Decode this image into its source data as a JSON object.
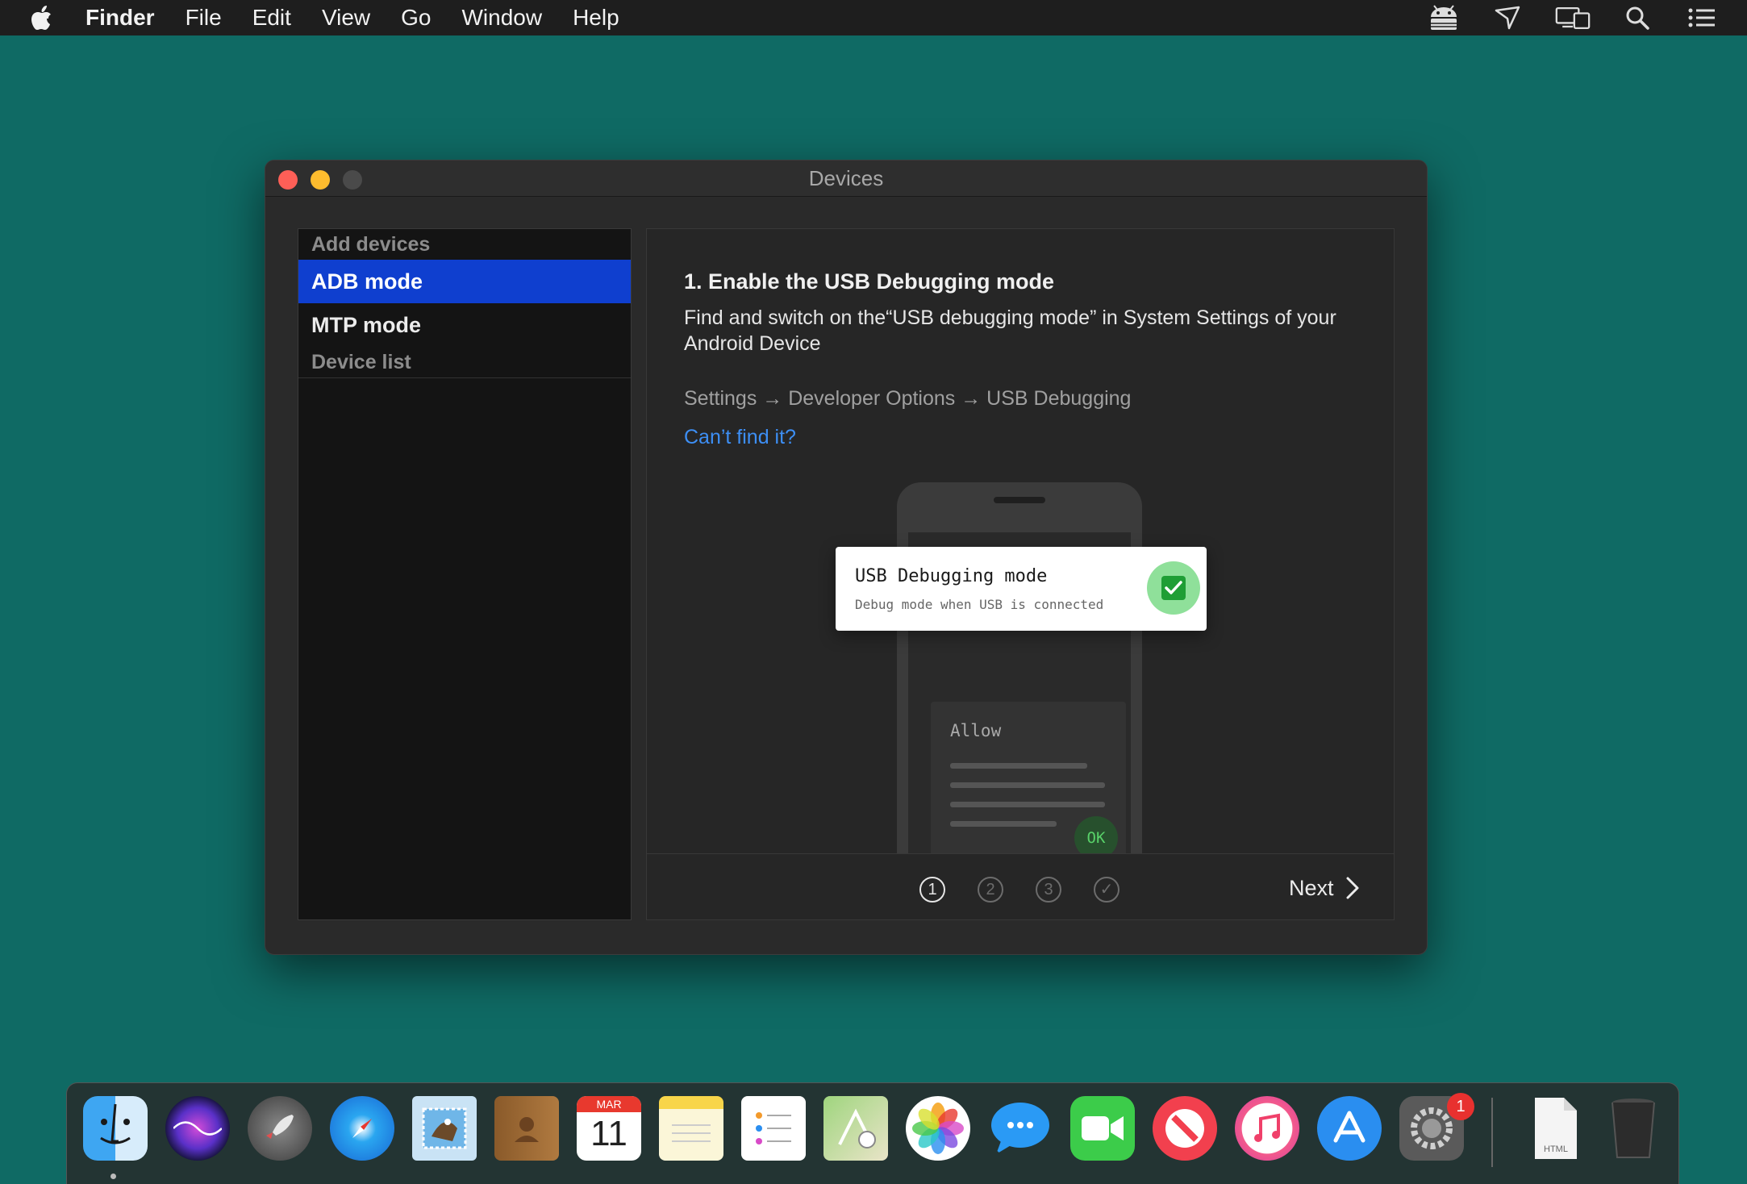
{
  "menubar": {
    "app_name": "Finder",
    "menus": [
      "File",
      "Edit",
      "View",
      "Go",
      "Window",
      "Help"
    ],
    "status_icons": [
      "android-icon",
      "airplay-icon",
      "display-icon",
      "search-icon",
      "list-icon"
    ]
  },
  "window": {
    "title": "Devices",
    "sidebar": {
      "header": "Add devices",
      "items": [
        {
          "label": "ADB mode",
          "selected": true
        },
        {
          "label": "MTP mode",
          "selected": false
        }
      ],
      "section": "Device list"
    },
    "main": {
      "step_title": "1. Enable the USB Debugging mode",
      "step_desc": "Find and switch on the“USB debugging mode” in System Settings of your Android Device",
      "path": "Settings → Developer Options → USB Debugging",
      "link": "Can’t find it?",
      "card": {
        "title": "USB Debugging mode",
        "subtitle": "Debug mode when USB is connected"
      },
      "allow_label": "Allow",
      "ok_label": "OK",
      "steps": [
        "1",
        "2",
        "3",
        "✓"
      ],
      "active_step": 1,
      "next_label": "Next"
    }
  },
  "dock": {
    "calendar_month": "MAR",
    "calendar_day": "11",
    "settings_badge": "1",
    "file_label": "HTML",
    "apps": [
      "finder-icon",
      "siri-icon",
      "launchpad-icon",
      "safari-icon",
      "mail-icon",
      "contacts-icon",
      "calendar-icon",
      "notes-icon",
      "reminders-icon",
      "maps-icon",
      "photos-icon",
      "messages-icon",
      "facetime-icon",
      "news-icon",
      "music-icon",
      "app-store-icon",
      "system-preferences-icon",
      "html-file-icon",
      "trash-icon"
    ]
  },
  "colors": {
    "desktop": "#0f6a64",
    "selection": "#0f3fcf",
    "link": "#3d8ff5",
    "check_green": "#1f9e35"
  }
}
